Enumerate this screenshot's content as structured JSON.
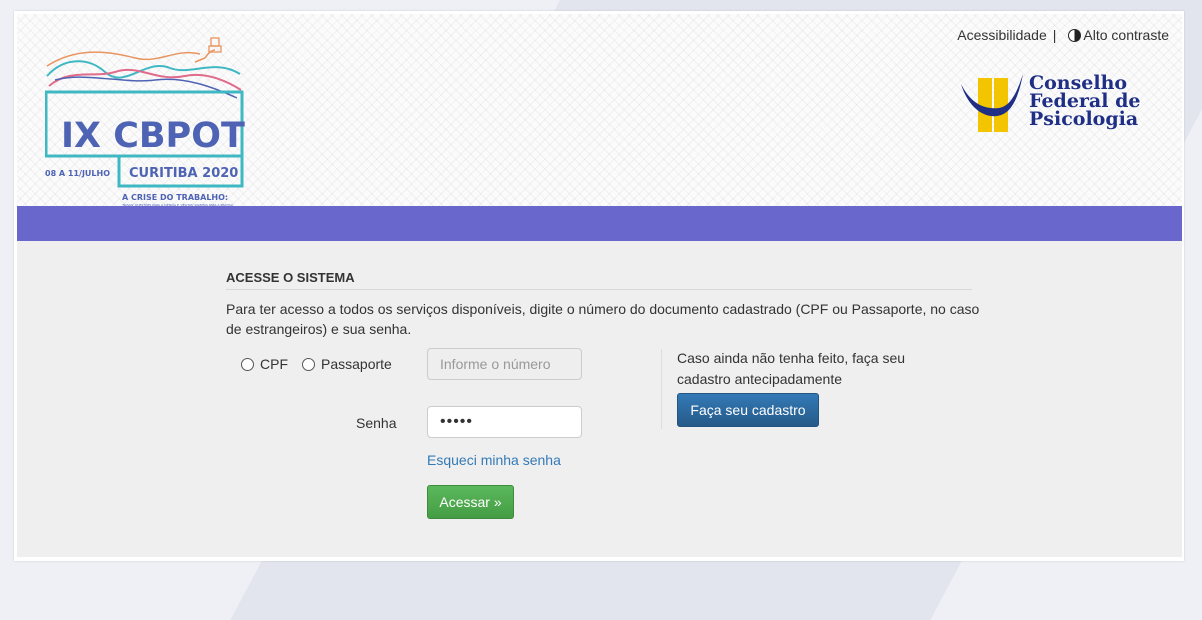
{
  "header": {
    "event_logo": {
      "title": "IX CBPOT",
      "dates": "08 A 11/JULHO",
      "city": "CURITIBA 2020",
      "theme": "A CRISE DO TRABALHO:",
      "subtheme": "'NOVAS' QUESTÕES PARA A CIÊNCIA E 'VELHOS' DILEMAS PARA A PRÁTICA",
      "colors": {
        "blue": "#4e63b3",
        "orange": "#e9945e",
        "pink": "#e06b8b",
        "teal": "#3fb8c4"
      }
    },
    "accessibility_label": "Acessibilidade",
    "separator": "|",
    "high_contrast_label": "Alto contraste",
    "org_logo": {
      "lines": [
        "Conselho",
        "Federal de",
        "Psicologia"
      ],
      "colors": {
        "navy": "#1f2f86",
        "yellow": "#f2c500"
      }
    }
  },
  "theme": {
    "bar_color": "#6a67cc",
    "primary": "#337ab7",
    "success": "#5cb85c"
  },
  "login": {
    "section_title": "ACESSE O SISTEMA",
    "intro": "Para ter acesso a todos os serviços disponíveis, digite o número do documento cadastrado (CPF ou Passaporte, no caso de estrangeiros) e sua senha.",
    "doc_options": [
      {
        "label": "CPF",
        "selected": false
      },
      {
        "label": "Passaporte",
        "selected": false
      }
    ],
    "number_placeholder": "Informe o número",
    "password_label": "Senha",
    "password_value": "•••••",
    "forgot_password": "Esqueci minha senha",
    "submit": "Acessar »"
  },
  "register": {
    "text": "Caso ainda não tenha feito, faça seu cadastro antecipadamente",
    "button": "Faça seu cadastro"
  }
}
